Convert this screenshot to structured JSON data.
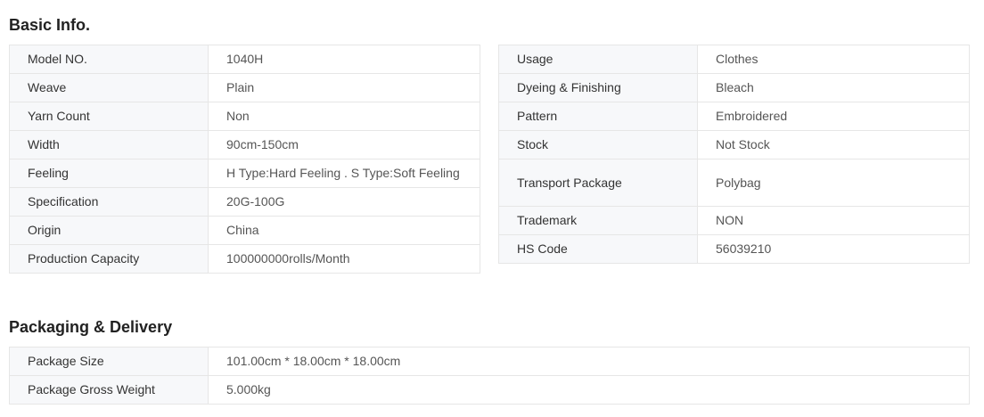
{
  "sections": {
    "basic_title": "Basic Info.",
    "packaging_title": "Packaging & Delivery"
  },
  "basic_left": [
    {
      "key": "Model NO.",
      "value": "1040H"
    },
    {
      "key": "Weave",
      "value": "Plain"
    },
    {
      "key": "Yarn Count",
      "value": "Non"
    },
    {
      "key": "Width",
      "value": "90cm-150cm"
    },
    {
      "key": "Feeling",
      "value": "H Type:Hard Feeling . S Type:Soft Feeling"
    },
    {
      "key": "Specification",
      "value": "20G-100G"
    },
    {
      "key": "Origin",
      "value": "China"
    },
    {
      "key": "Production Capacity",
      "value": "100000000rolls/Month"
    }
  ],
  "basic_right": [
    {
      "key": "Usage",
      "value": "Clothes"
    },
    {
      "key": "Dyeing & Finishing",
      "value": "Bleach"
    },
    {
      "key": "Pattern",
      "value": "Embroidered"
    },
    {
      "key": "Stock",
      "value": "Not Stock"
    },
    {
      "key": "Transport Package",
      "value": "Polybag"
    },
    {
      "key": "Trademark",
      "value": "NON"
    },
    {
      "key": "HS Code",
      "value": "56039210"
    }
  ],
  "packaging": [
    {
      "key": "Package Size",
      "value": "101.00cm * 18.00cm * 18.00cm"
    },
    {
      "key": "Package Gross Weight",
      "value": "5.000kg"
    }
  ]
}
